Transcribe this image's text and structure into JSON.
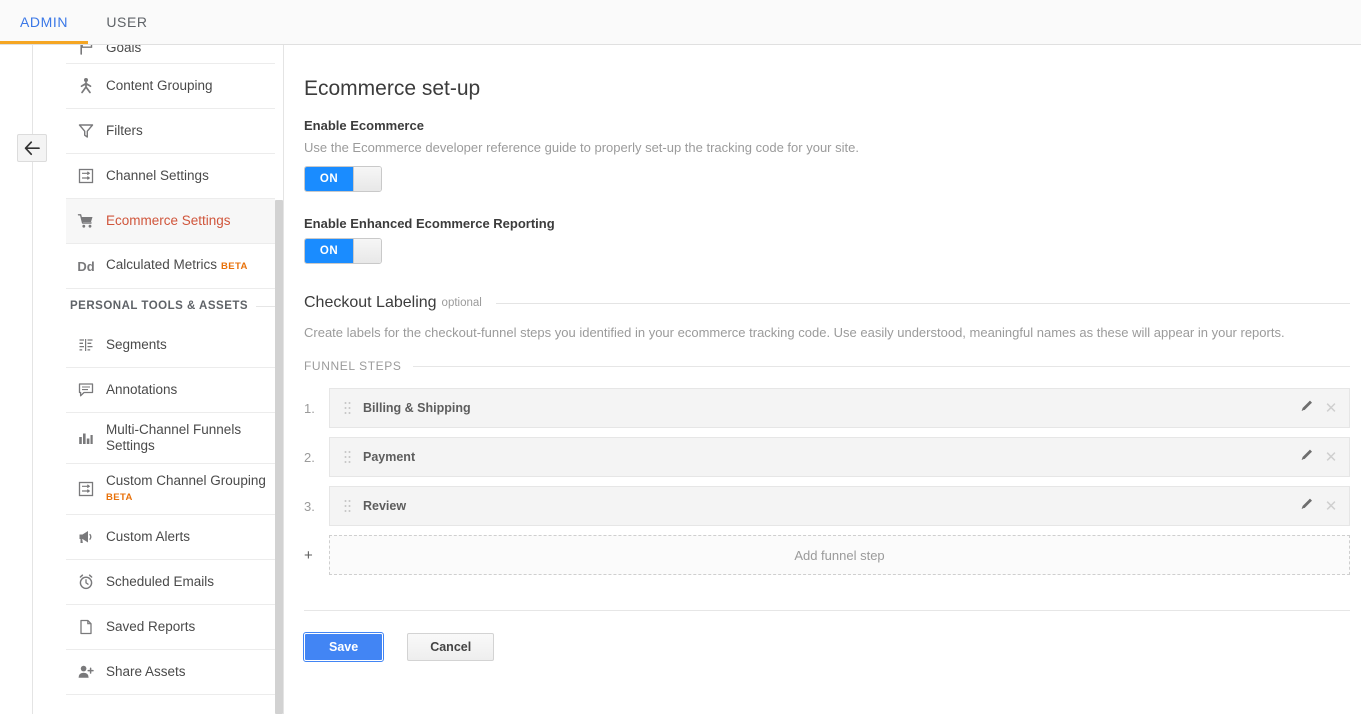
{
  "topbar": {
    "tabs": [
      {
        "label": "ADMIN",
        "active": true
      },
      {
        "label": "USER",
        "active": false
      }
    ]
  },
  "rail": {
    "back_icon": "arrow-left-icon"
  },
  "sidebar": {
    "items": [
      {
        "label": "Goals",
        "icon": "flag-icon",
        "selected": false,
        "partial": true
      },
      {
        "label": "Content Grouping",
        "icon": "person-grouping-icon",
        "selected": false
      },
      {
        "label": "Filters",
        "icon": "funnel-icon",
        "selected": false
      },
      {
        "label": "Channel Settings",
        "icon": "channel-icon",
        "selected": false
      },
      {
        "label": "Ecommerce Settings",
        "icon": "shopping-cart-icon",
        "selected": true
      },
      {
        "label": "Calculated Metrics",
        "icon": "dd-icon",
        "badge": "BETA",
        "selected": false
      }
    ],
    "section_header": "PERSONAL TOOLS & ASSETS",
    "personal_items": [
      {
        "label": "Segments",
        "icon": "segments-icon",
        "selected": false
      },
      {
        "label": "Annotations",
        "icon": "comment-icon",
        "selected": false
      },
      {
        "label": "Multi-Channel Funnels Settings",
        "icon": "bar-chart-icon",
        "selected": false
      },
      {
        "label": "Custom Channel Grouping",
        "icon": "channel-icon",
        "badge": "BETA",
        "selected": false
      },
      {
        "label": "Custom Alerts",
        "icon": "megaphone-icon",
        "selected": false
      },
      {
        "label": "Scheduled Emails",
        "icon": "alarm-clock-icon",
        "selected": false
      },
      {
        "label": "Saved Reports",
        "icon": "document-icon",
        "selected": false
      },
      {
        "label": "Share Assets",
        "icon": "person-add-icon",
        "selected": false
      }
    ]
  },
  "main": {
    "title": "Ecommerce set-up",
    "enable_ecommerce": {
      "label": "Enable Ecommerce",
      "description": "Use the Ecommerce developer reference guide to properly set-up the tracking code for your site.",
      "toggle_state": "ON"
    },
    "enhanced_ecommerce": {
      "label": "Enable Enhanced Ecommerce Reporting",
      "toggle_state": "ON"
    },
    "checkout_labeling": {
      "title": "Checkout Labeling",
      "optional": "optional",
      "description": "Create labels for the checkout-funnel steps you identified in your ecommerce tracking code. Use easily understood, meaningful names as these will appear in your reports.",
      "funnel_steps_header": "FUNNEL STEPS",
      "steps": [
        {
          "number": "1.",
          "name": "Billing & Shipping"
        },
        {
          "number": "2.",
          "name": "Payment"
        },
        {
          "number": "3.",
          "name": "Review"
        }
      ],
      "add_step": {
        "plus": "+",
        "label": "Add funnel step"
      }
    },
    "save_label": "Save",
    "cancel_label": "Cancel"
  },
  "colors": {
    "accent_blue": "#4285f4",
    "toggle_blue": "#1a8cff",
    "selected_red": "#d0563c",
    "beta_orange": "#e8710a",
    "tab_underline": "#f5a623"
  }
}
